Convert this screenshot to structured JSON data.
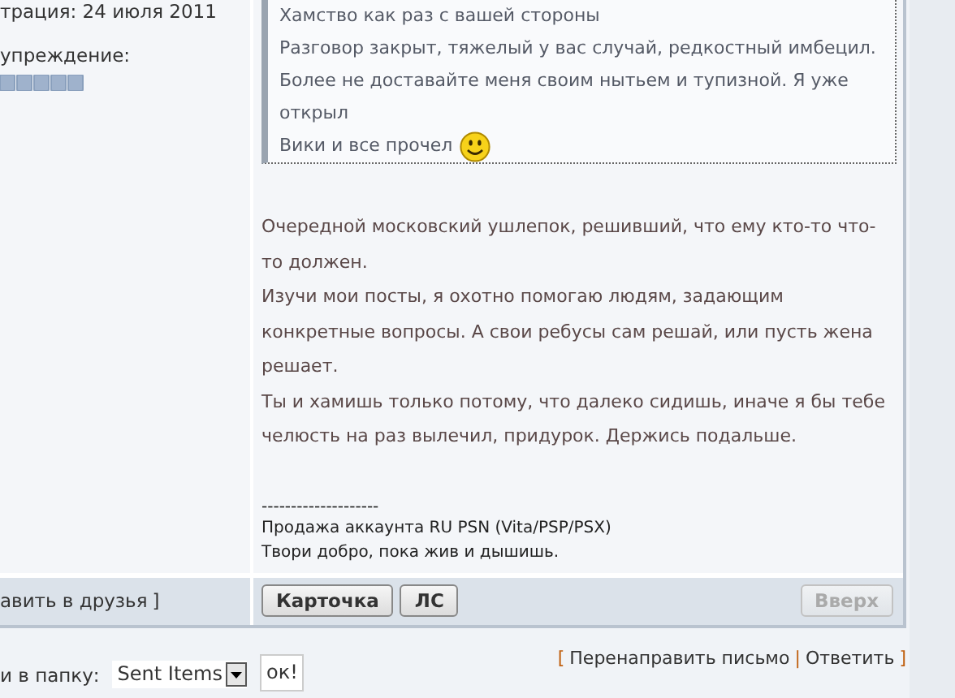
{
  "user_info": {
    "registration": "трация: 24 июля 2011",
    "warning_label": "упреждение:"
  },
  "quote": {
    "lines": [
      "Хамство как раз с вашей стороны",
      "Разговор закрыт, тяжелый у вас случай, редкостный имбецил.",
      "Более не доставайте меня своим нытьем и тупизной. Я уже открыл",
      "Вики и все прочел"
    ]
  },
  "post": {
    "paragraphs": [
      "Очередной московский ушлепок, решивший, что ему кто-то что-то должен.",
      "Изучи мои посты, я охотно помогаю людям, задающим конкретные вопросы. А свои ребусы сам решай, или пусть жена решает.",
      "Ты и хамишь только потому, что далеко сидишь, иначе я бы тебе челюсть на раз вылечил, придурок. Держись подальше."
    ],
    "signature_rule": "--------------------",
    "signature": [
      "Продажа аккаунта RU PSN (Vita/PSP/PSX)",
      "Твори добро, пока жив и дышишь."
    ]
  },
  "post_footer": {
    "add_friend": "авить в друзья",
    "add_friend_close": "]",
    "buttons": [
      {
        "label": "Карточка",
        "disabled": false
      },
      {
        "label": "ЛС",
        "disabled": false
      },
      {
        "label": "Вверх",
        "disabled": true
      }
    ]
  },
  "bottom": {
    "move_label": "и в папку:",
    "folder": "Sent Items",
    "ok": "ок!",
    "open": "[",
    "links": [
      "Перенаправить письмо",
      "Ответить"
    ],
    "separator": "|",
    "close": "]"
  }
}
